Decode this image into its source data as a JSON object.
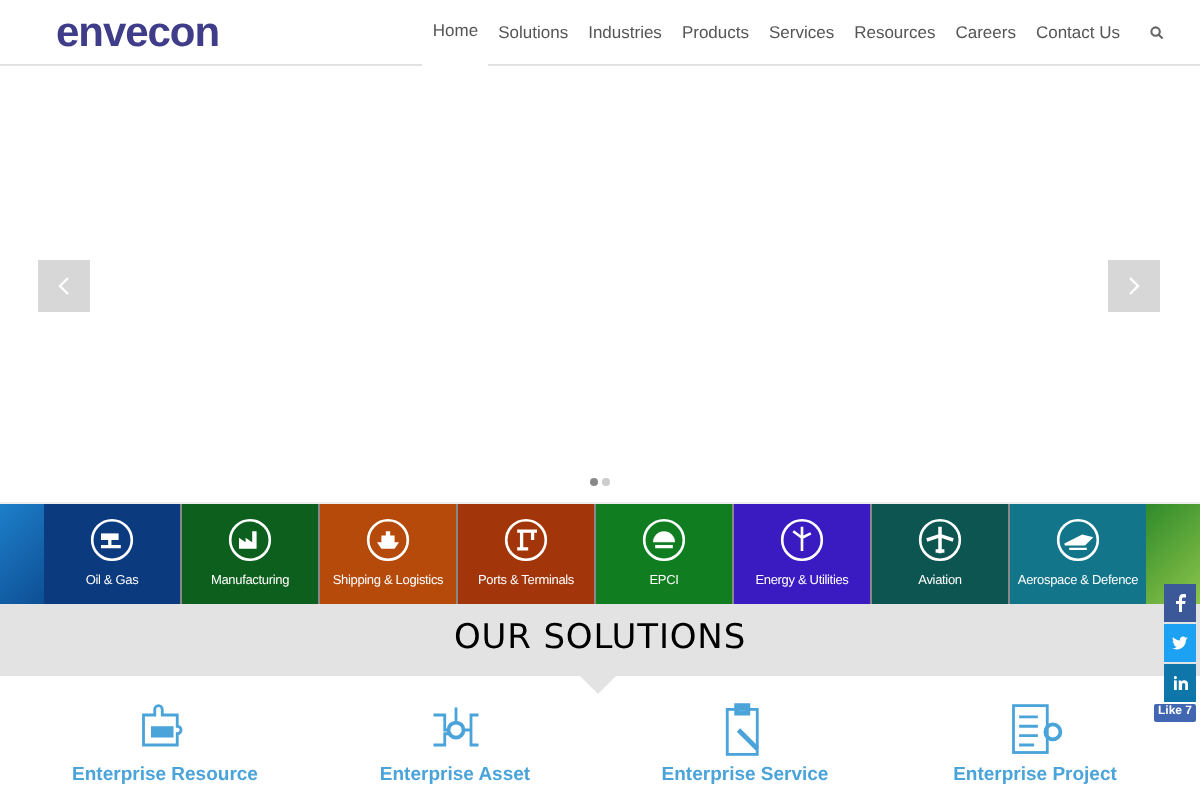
{
  "header": {
    "logo": "envecon",
    "nav": [
      {
        "label": "Home",
        "selected": true
      },
      {
        "label": "Solutions",
        "selected": false
      },
      {
        "label": "Industries",
        "selected": false
      },
      {
        "label": "Products",
        "selected": false
      },
      {
        "label": "Services",
        "selected": false
      },
      {
        "label": "Resources",
        "selected": false
      },
      {
        "label": "Careers",
        "selected": false
      },
      {
        "label": "Contact Us",
        "selected": false
      }
    ]
  },
  "slider": {
    "dots": [
      {
        "selected": true
      },
      {
        "selected": false
      }
    ]
  },
  "industries": [
    {
      "label": "Oil & Gas",
      "color": "#0b3a7e",
      "kind": "oil"
    },
    {
      "label": "Manufacturing",
      "color": "#0d5f1e",
      "kind": "factory"
    },
    {
      "label": "Shipping & Logistics",
      "color": "#b54a0b",
      "kind": "ship"
    },
    {
      "label": "Ports & Terminals",
      "color": "#a3350a",
      "kind": "crane"
    },
    {
      "label": "EPCI",
      "color": "#0f7d20",
      "kind": "helmet"
    },
    {
      "label": "Energy & Utilities",
      "color": "#3a1bc2",
      "kind": "wind"
    },
    {
      "label": "Aviation",
      "color": "#0c5550",
      "kind": "plane"
    },
    {
      "label": "Aerospace & Defence",
      "color": "#127589",
      "kind": "jet"
    }
  ],
  "solutions": {
    "heading": "OUR SOLUTIONS",
    "items": [
      {
        "title": "Enterprise Resource",
        "kind": "erp"
      },
      {
        "title": "Enterprise Asset",
        "kind": "asset"
      },
      {
        "title": "Enterprise Service",
        "kind": "service"
      },
      {
        "title": "Enterprise Project",
        "kind": "project"
      }
    ]
  },
  "social": {
    "like": "Like 7"
  }
}
